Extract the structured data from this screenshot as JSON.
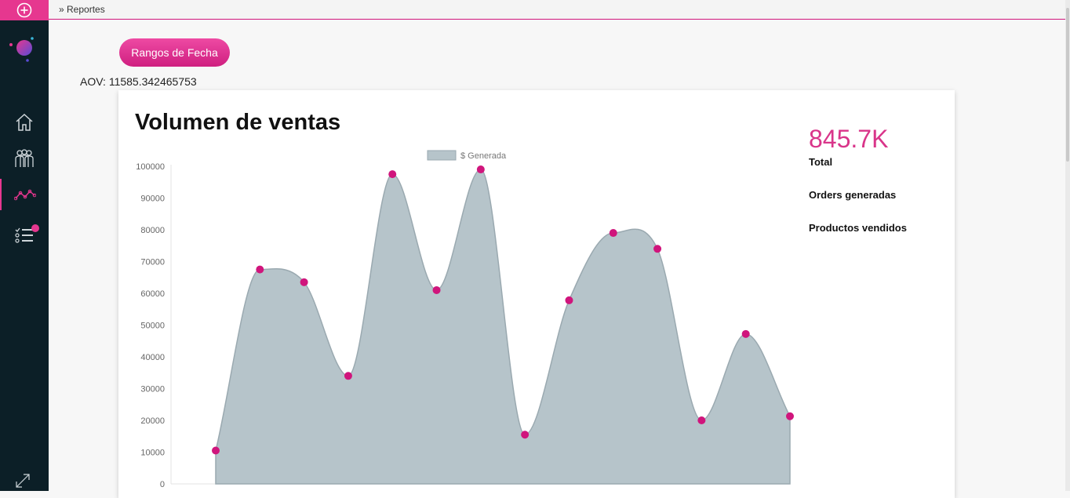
{
  "breadcrumb": "» Reportes",
  "date_button": "Rangos de Fecha",
  "aov_text": "AOV: 11585.342465753",
  "card": {
    "title": "Volumen de ventas",
    "total_value": "845.7K",
    "total_label": "Total",
    "orders_label": "Orders generadas",
    "products_label": "Productos vendidos"
  },
  "sidebar": {
    "items": [
      {
        "icon": "home-icon"
      },
      {
        "icon": "users-icon"
      },
      {
        "icon": "chart-line-icon",
        "active": true
      },
      {
        "icon": "task-list-icon"
      }
    ],
    "accent": "#e6378f",
    "background": "#0c1f27"
  },
  "chart_data": {
    "type": "area",
    "legend_position": "top",
    "series": [
      {
        "name": "$ Generada",
        "fill": "#b6c4ca",
        "point_color": "#d0157c",
        "values": [
          10500,
          67500,
          63500,
          34000,
          97500,
          61000,
          99000,
          15500,
          57800,
          79000,
          74000,
          20000,
          47200,
          21300
        ]
      }
    ],
    "ylim": [
      0,
      100000
    ],
    "yticks": [
      "0",
      "10000",
      "20000",
      "30000",
      "40000",
      "50000",
      "60000",
      "70000",
      "80000",
      "90000",
      "100000"
    ]
  }
}
